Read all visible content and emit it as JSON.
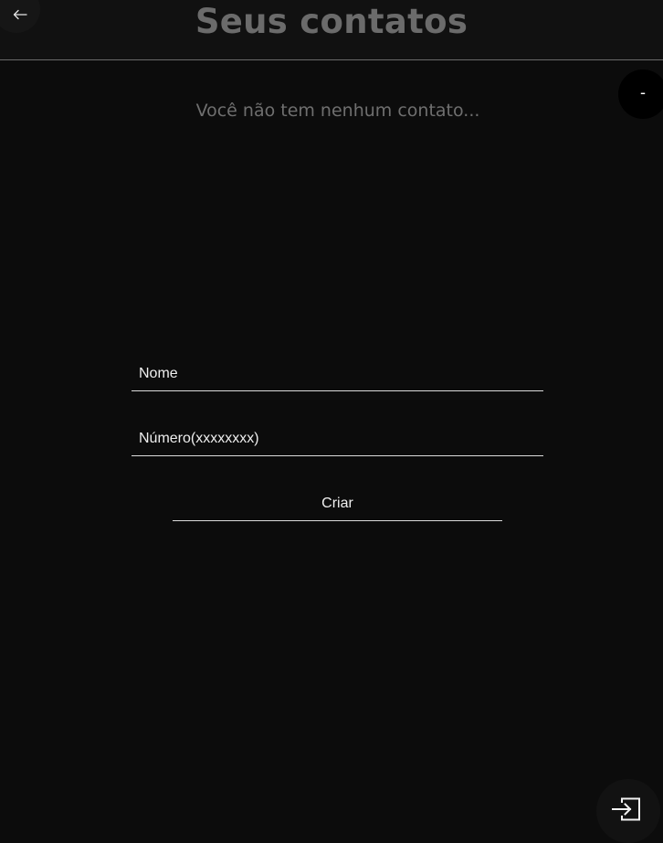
{
  "header": {
    "title": "Seus contatos",
    "back_icon": "arrow-left-icon"
  },
  "toggle_label": "-",
  "contacts": {
    "empty_message": "Você não tem nenhum contato..."
  },
  "form": {
    "name_placeholder": "Nome",
    "number_placeholder": "Número(xxxxxxxx)",
    "name_value": "",
    "number_value": "",
    "submit_label": "Criar"
  },
  "logout": {
    "icon": "logout-icon"
  },
  "colors": {
    "background": "#0c0c0c",
    "header_background": "#111111",
    "title": "#6b6b6b",
    "muted_text": "#6f6f6f",
    "text": "#eeeeee",
    "divider": "#dcdcdc"
  }
}
